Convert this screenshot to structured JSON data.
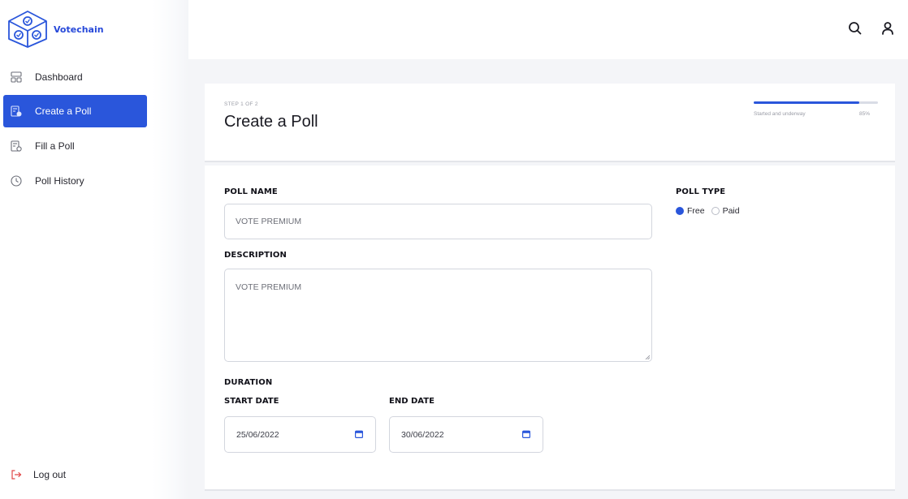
{
  "app": {
    "name": "Votechain",
    "brand_color": "#2a56db"
  },
  "sidebar": {
    "items": [
      {
        "label": "Dashboard",
        "icon": "dashboard-icon",
        "active": false
      },
      {
        "label": "Create a Poll",
        "icon": "create-poll-icon",
        "active": true
      },
      {
        "label": "Fill a Poll",
        "icon": "fill-poll-icon",
        "active": false
      },
      {
        "label": "Poll History",
        "icon": "history-icon",
        "active": false
      }
    ],
    "logout_label": "Log out"
  },
  "header": {
    "icons": [
      "search-icon",
      "user-icon"
    ]
  },
  "page": {
    "step": "STEP 1 OF 2",
    "title": "Create a Poll",
    "progress": {
      "label": "Started and underway",
      "percent_text": "85%",
      "value": 0.85
    }
  },
  "form": {
    "poll_name": {
      "label": "POLL NAME",
      "placeholder": "VOTE PREMIUM"
    },
    "description": {
      "label": "DESCRIPTION",
      "placeholder": "VOTE PREMIUM"
    },
    "duration": {
      "label": "DURATION",
      "start_label": "START DATE",
      "start_value": "25/06/2022",
      "end_label": "END DATE",
      "end_value": "30/06/2022"
    },
    "poll_type": {
      "label": "POLL TYPE",
      "options": [
        "Free",
        "Paid"
      ],
      "selected": "Free"
    }
  }
}
